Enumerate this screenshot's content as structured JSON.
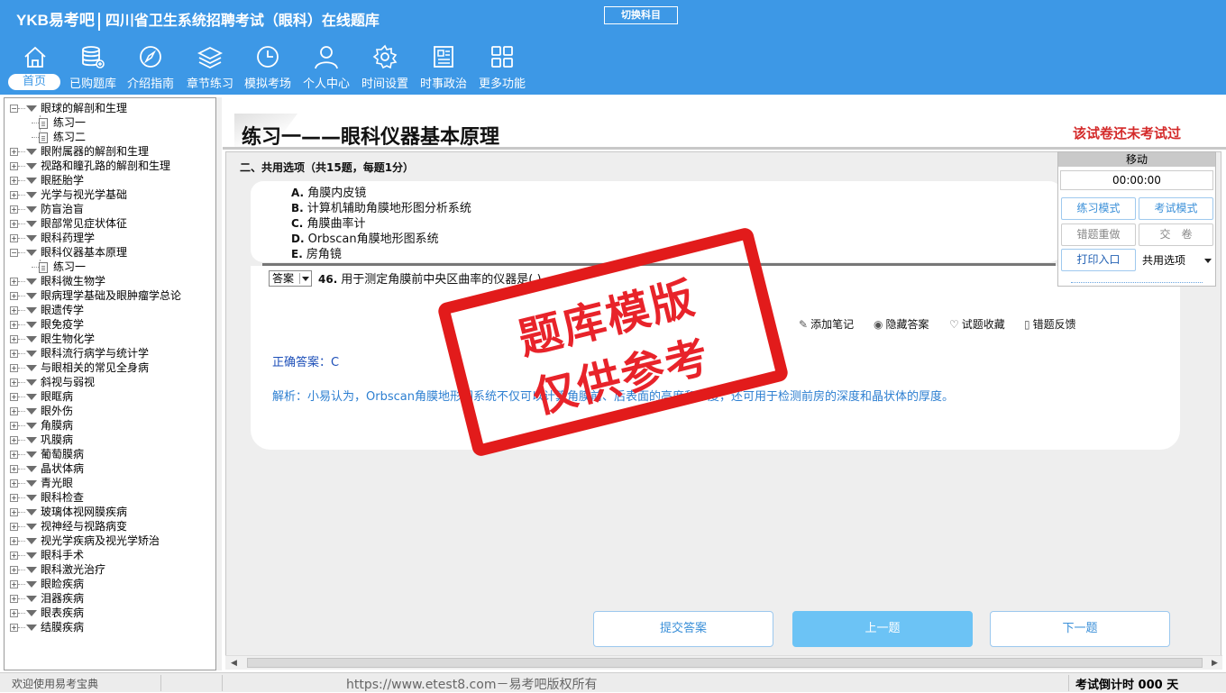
{
  "header": {
    "brand": "YKB易考吧",
    "title": "四川省卫生系统招聘考试（眼科）在线题库",
    "switch_subject": "切换科目"
  },
  "nav": [
    {
      "label": "首页",
      "icon": "home-icon",
      "active": true
    },
    {
      "label": "已购题库",
      "icon": "database-icon"
    },
    {
      "label": "介绍指南",
      "icon": "compass-icon"
    },
    {
      "label": "章节练习",
      "icon": "layers-icon"
    },
    {
      "label": "模拟考场",
      "icon": "clock-icon"
    },
    {
      "label": "个人中心",
      "icon": "user-icon"
    },
    {
      "label": "时间设置",
      "icon": "gear-icon"
    },
    {
      "label": "时事政治",
      "icon": "newspaper-icon"
    },
    {
      "label": "更多功能",
      "icon": "grid-icon"
    }
  ],
  "tree": [
    {
      "label": "眼球的解剖和生理",
      "expanded": true,
      "children": [
        "练习一",
        "练习二"
      ]
    },
    {
      "label": "眼附属器的解剖和生理"
    },
    {
      "label": "视路和瞳孔路的解剖和生理"
    },
    {
      "label": "眼胚胎学"
    },
    {
      "label": "光学与视光学基础"
    },
    {
      "label": "防盲治盲"
    },
    {
      "label": "眼部常见症状体征"
    },
    {
      "label": "眼科药理学"
    },
    {
      "label": "眼科仪器基本原理",
      "expanded": true,
      "children": [
        "练习一"
      ]
    },
    {
      "label": "眼科微生物学"
    },
    {
      "label": "眼病理学基础及眼肿瘤学总论"
    },
    {
      "label": "眼遗传学"
    },
    {
      "label": "眼免疫学"
    },
    {
      "label": "眼生物化学"
    },
    {
      "label": "眼科流行病学与统计学"
    },
    {
      "label": "与眼相关的常见全身病"
    },
    {
      "label": "斜视与弱视"
    },
    {
      "label": "眼眶病"
    },
    {
      "label": "眼外伤"
    },
    {
      "label": "角膜病"
    },
    {
      "label": "巩膜病"
    },
    {
      "label": "葡萄膜病"
    },
    {
      "label": "晶状体病"
    },
    {
      "label": "青光眼"
    },
    {
      "label": "眼科检查"
    },
    {
      "label": "玻璃体视网膜疾病"
    },
    {
      "label": "视神经与视路病变"
    },
    {
      "label": "视光学疾病及视光学矫治"
    },
    {
      "label": "眼科手术"
    },
    {
      "label": "眼科激光治疗"
    },
    {
      "label": "眼睑疾病"
    },
    {
      "label": "泪器疾病"
    },
    {
      "label": "眼表疾病"
    },
    {
      "label": "结膜疾病"
    }
  ],
  "exercise": {
    "title": "练习一——眼科仪器基本原理",
    "status": "该试卷还未考试过",
    "section": "二、共用选项（共15题，每题1分）",
    "options": [
      {
        "letter": "A.",
        "text": "角膜内皮镜"
      },
      {
        "letter": "B.",
        "text": "计算机辅助角膜地形图分析系统"
      },
      {
        "letter": "C.",
        "text": "角膜曲率计"
      },
      {
        "letter": "D.",
        "text": "Orbscan角膜地形图系统"
      },
      {
        "letter": "E.",
        "text": "房角镜"
      }
    ],
    "answer_select": "答案",
    "question_number": "46.",
    "question_text": "用于测定角膜前中央区曲率的仪器是(   )。",
    "tools": {
      "add_note": "添加笔记",
      "hide_answer": "隐藏答案",
      "favorite": "试题收藏",
      "report_error": "错题反馈"
    },
    "correct_answer": "正确答案：C",
    "analysis": "解析：小易认为，Orbscan角膜地形图系统不仅可以计算角膜前、后表面的高度和厚度，还可用于检测前房的深度和晶状体的厚度。"
  },
  "panel": {
    "move": "移动",
    "timer": "00:00:00",
    "practice_mode": "练习模式",
    "exam_mode": "考试模式",
    "redo_wrong": "错题重做",
    "submit_paper": "交　卷",
    "print_entry": "打印入口",
    "option_type": "共用选项"
  },
  "buttons": {
    "submit": "提交答案",
    "prev": "上一题",
    "next": "下一题"
  },
  "watermark": {
    "line1": "题库模版",
    "line2": "仅供参考"
  },
  "status": {
    "welcome": "欢迎使用易考宝典",
    "copyright": "https://www.etest8.com－易考吧版权所有",
    "countdown": "考试倒计时 000 天"
  },
  "colors": {
    "header_bg": "#3d98e6",
    "status_red": "#d42a2a",
    "answer_blue": "#1d4fb8",
    "analysis_blue": "#2d7fd1",
    "primary_button": "#6cc3f5"
  }
}
